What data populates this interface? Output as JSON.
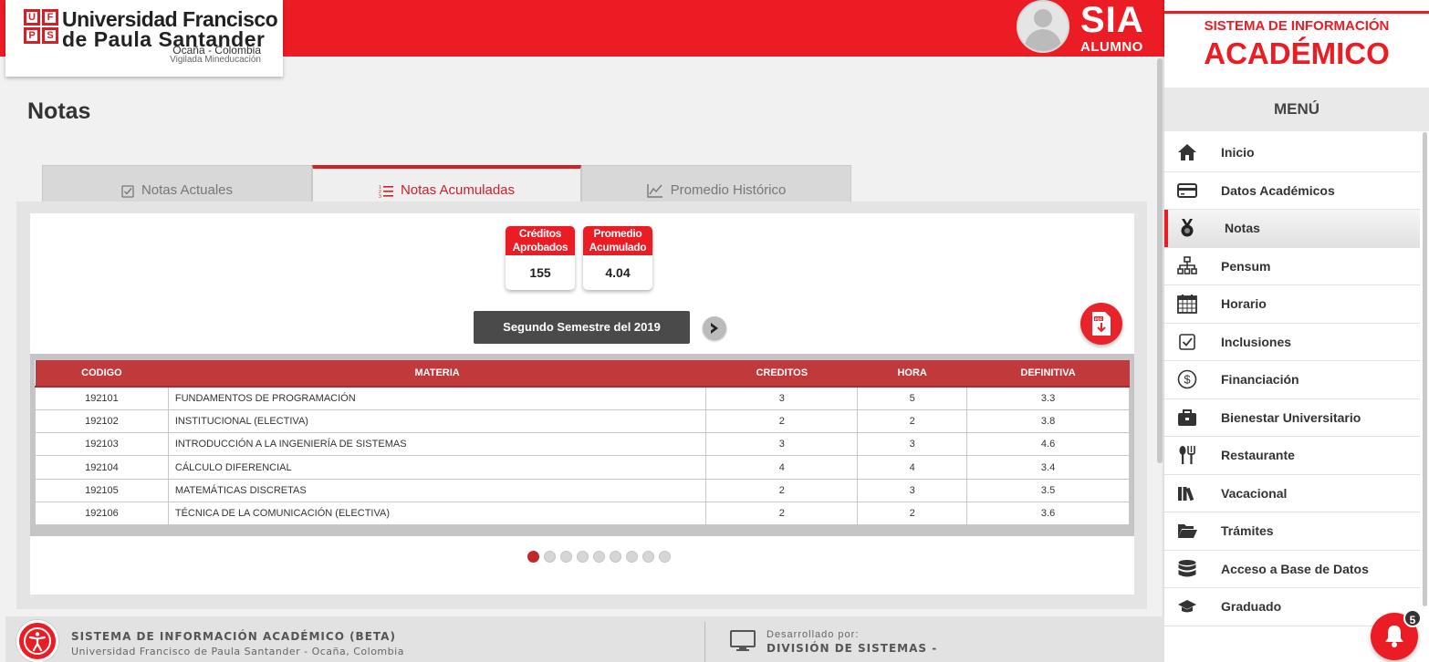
{
  "header": {
    "logo_line1": "Universidad Francisco",
    "logo_line2": "de Paula Santander",
    "logo_line3": "Ocaña - Colombia",
    "logo_line4": "Vigilada Mineducación",
    "logo_mark": [
      "U",
      "F",
      "P",
      "S"
    ],
    "app_name": "SIA",
    "app_role": "ALUMNO",
    "bar_color": "#ec1c24"
  },
  "sidebar": {
    "system_label": "SISTEMA DE INFORMACIÓN",
    "system_title": "ACADÉMICO",
    "menu_title": "MENÚ",
    "items": [
      {
        "label": "Inicio",
        "icon": "home-icon"
      },
      {
        "label": "Datos Académicos",
        "icon": "credit-card-icon"
      },
      {
        "label": "Notas",
        "icon": "medal-icon",
        "active": true
      },
      {
        "label": "Pensum",
        "icon": "sitemap-icon"
      },
      {
        "label": "Horario",
        "icon": "calendar-icon"
      },
      {
        "label": "Inclusiones",
        "icon": "checkbox-icon"
      },
      {
        "label": "Financiación",
        "icon": "dollar-circle-icon"
      },
      {
        "label": "Bienestar Universitario",
        "icon": "briefcase-icon"
      },
      {
        "label": "Restaurante",
        "icon": "utensils-icon"
      },
      {
        "label": "Vacacional",
        "icon": "books-icon"
      },
      {
        "label": "Trámites",
        "icon": "folder-open-icon"
      },
      {
        "label": "Acceso a Base de Datos",
        "icon": "database-icon"
      },
      {
        "label": "Graduado",
        "icon": "graduation-cap-icon"
      }
    ],
    "notification_count": "5"
  },
  "main": {
    "page_title": "Notas",
    "tabs": [
      {
        "label": "Notas Actuales",
        "icon": "checkbox-icon"
      },
      {
        "label": "Notas Acumuladas",
        "icon": "list-icon",
        "active": true
      },
      {
        "label": "Promedio Histórico",
        "icon": "line-chart-icon"
      }
    ],
    "stats": {
      "creditos_label": "Créditos Aprobados",
      "creditos_value": "155",
      "promedio_label": "Promedio Acumulado",
      "promedio_value": "4.04"
    },
    "semester_label": "Segundo Semestre del 2019",
    "pdf_label": "PDF",
    "table": {
      "headers": [
        "CODIGO",
        "MATERIA",
        "CREDITOS",
        "HORA",
        "DEFINITIVA"
      ],
      "rows": [
        [
          "192101",
          "FUNDAMENTOS DE PROGRAMACIÓN",
          "3",
          "5",
          "3.3"
        ],
        [
          "192102",
          "INSTITUCIONAL (ELECTIVA)",
          "2",
          "2",
          "3.8"
        ],
        [
          "192103",
          "INTRODUCCIÓN A LA INGENIERÍA DE SISTEMAS",
          "3",
          "3",
          "4.6"
        ],
        [
          "192104",
          "CÁLCULO DIFERENCIAL",
          "4",
          "4",
          "3.4"
        ],
        [
          "192105",
          "MATEMÁTICAS DISCRETAS",
          "2",
          "3",
          "3.5"
        ],
        [
          "192106",
          "TÉCNICA DE LA COMUNICACIÓN (ELECTIVA)",
          "2",
          "2",
          "3.6"
        ]
      ]
    },
    "pagination": {
      "total": 9,
      "current": 1
    }
  },
  "footer": {
    "title": "SISTEMA DE INFORMACIÓN ACADÉMICO (BETA)",
    "subtitle": "Universidad Francisco de Paula Santander - Ocaña, Colombia",
    "dev_label": "Desarrollado por:",
    "dev_name": "DIVISIÓN DE SISTEMAS -"
  }
}
